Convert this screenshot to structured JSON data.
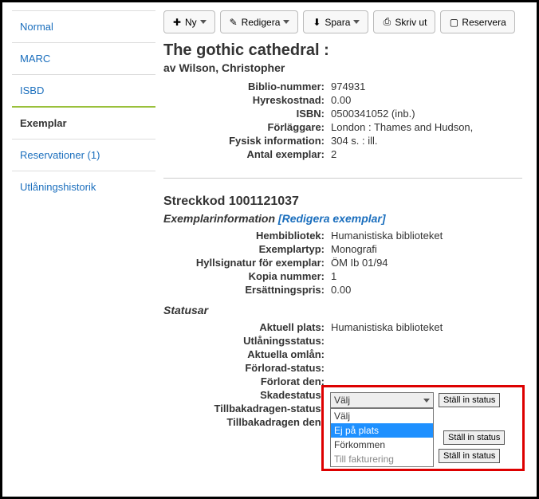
{
  "sidebar": {
    "items": [
      {
        "label": "Normal"
      },
      {
        "label": "MARC"
      },
      {
        "label": "ISBD"
      },
      {
        "label": "Exemplar"
      },
      {
        "label": "Reservationer (1)"
      },
      {
        "label": "Utlåningshistorik"
      }
    ]
  },
  "toolbar": {
    "new": "Ny",
    "edit": "Redigera",
    "save": "Spara",
    "print": "Skriv ut",
    "reserve": "Reservera"
  },
  "record": {
    "title": "The gothic cathedral :",
    "author_prefix": "av ",
    "author": "Wilson, Christopher",
    "fields": [
      {
        "label": "Biblio-nummer:",
        "value": "974931"
      },
      {
        "label": "Hyreskostnad:",
        "value": "0.00"
      },
      {
        "label": "ISBN:",
        "value": "0500341052 (inb.)"
      },
      {
        "label": "Förläggare:",
        "value": "London : Thames and Hudson,"
      },
      {
        "label": "Fysisk information:",
        "value": "304 s. : ill."
      },
      {
        "label": "Antal exemplar:",
        "value": "2"
      }
    ]
  },
  "item": {
    "barcode_label": "Streckkod",
    "barcode": "1001121037",
    "info_head": "Exemplarinformation",
    "edit_link": "[Redigera exemplar]",
    "fields": [
      {
        "label": "Hembibliotek:",
        "value": "Humanistiska biblioteket"
      },
      {
        "label": "Exemplartyp:",
        "value": "Monografi"
      },
      {
        "label": "Hyllsignatur för exemplar:",
        "value": "ÖM Ib 01/94"
      },
      {
        "label": "Kopia nummer:",
        "value": "1"
      },
      {
        "label": "Ersättningspris:",
        "value": "0.00"
      }
    ]
  },
  "statuses": {
    "head": "Statusar",
    "rows": [
      {
        "label": "Aktuell plats:",
        "value": "Humanistiska biblioteket"
      },
      {
        "label": "Utlåningsstatus:",
        "value": ""
      },
      {
        "label": "Aktuella omlån:",
        "value": ""
      },
      {
        "label": "Förlorad-status:",
        "value": ""
      },
      {
        "label": "Förlorat den:",
        "value": ""
      },
      {
        "label": "Skadestatus:",
        "value": ""
      },
      {
        "label": "Tillbakadragen-status:",
        "value": ""
      },
      {
        "label": "Tillbakadragen den:",
        "value": ""
      }
    ],
    "set_btn": "Ställ in status",
    "lost_select": {
      "current": "Välj",
      "options": [
        "Välj",
        "Ej på plats",
        "Förkommen",
        "Till fakturering"
      ]
    }
  }
}
